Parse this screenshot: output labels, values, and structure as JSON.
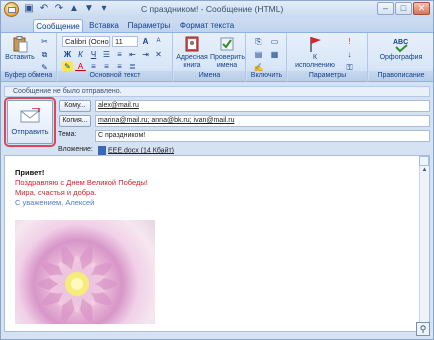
{
  "window": {
    "title": "С праздником! - Сообщение (HTML)",
    "minimize": "–",
    "maximize": "□",
    "close": "✕"
  },
  "tabs": [
    "Сообщение",
    "Вставка",
    "Параметры",
    "Формат текста"
  ],
  "ribbon": {
    "clipboard": {
      "paste": "Вставить",
      "group": "Буфер обмена"
    },
    "basic_text": {
      "font": "Calibri (Осно",
      "size": "11",
      "bold": "Ж",
      "italic": "К",
      "underline": "Ч",
      "grow": "A",
      "shrink": "A",
      "group": "Основной текст"
    },
    "names": {
      "address_book": "Адресная книга",
      "check_names": "Проверить имена",
      "group": "Имена"
    },
    "include": {
      "group": "Включить"
    },
    "options": {
      "followup": "К исполнению",
      "group": "Параметры"
    },
    "proofing": {
      "spelling": "Орфография",
      "group": "Правописание"
    }
  },
  "notice": "Сообщение не было отправлено.",
  "send_button": "Отправить",
  "fields": {
    "to_button": "Кому...",
    "to_value": "alex@mail.ru",
    "cc_button": "Копия...",
    "cc_value": "marina@mail.ru; anna@bk.ru; ivan@mail.ru",
    "subject_label": "Тема:",
    "subject_value": "С праздником!",
    "attachment_label": "Вложение:",
    "attachment_value": "EEE.docx (14 Кбайт)"
  },
  "message": {
    "greeting": "Привет!",
    "line1": "Поздравляю с Днем Великой Победы!",
    "line2": "Мира, счастья и добра.",
    "signature": "С уважением, Алексей"
  },
  "colors": {
    "accent_red": "#d3232d",
    "signature_blue": "#4f7ac7",
    "ribbon_text": "#15428b"
  }
}
